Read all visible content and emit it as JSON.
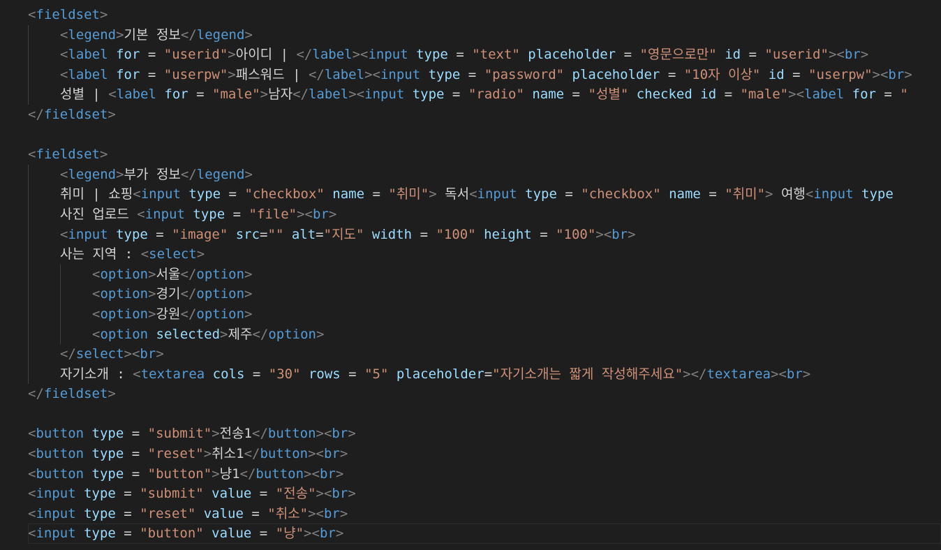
{
  "colors": {
    "background": "#1e1e1e",
    "tag": "#569cd6",
    "bracket": "#808080",
    "attribute": "#9cdcfe",
    "string": "#ce9178",
    "text": "#d4d4d4",
    "indent_guide": "#404040"
  },
  "lines": [
    {
      "indent": 0,
      "tokens": [
        [
          "p",
          "<"
        ],
        [
          "t",
          "fieldset"
        ],
        [
          "p",
          ">"
        ]
      ]
    },
    {
      "indent": 1,
      "tokens": [
        [
          "p",
          "<"
        ],
        [
          "t",
          "legend"
        ],
        [
          "p",
          ">"
        ],
        [
          "x",
          "기본 정보"
        ],
        [
          "p",
          "</"
        ],
        [
          "t",
          "legend"
        ],
        [
          "p",
          ">"
        ]
      ]
    },
    {
      "indent": 1,
      "tokens": [
        [
          "p",
          "<"
        ],
        [
          "t",
          "label "
        ],
        [
          "a",
          "for"
        ],
        [
          "x",
          " = "
        ],
        [
          "v",
          "\"userid\""
        ],
        [
          "p",
          ">"
        ],
        [
          "x",
          "아이디 | "
        ],
        [
          "p",
          "</"
        ],
        [
          "t",
          "label"
        ],
        [
          "p",
          "><"
        ],
        [
          "t",
          "input "
        ],
        [
          "a",
          "type"
        ],
        [
          "x",
          " = "
        ],
        [
          "v",
          "\"text\""
        ],
        [
          "x",
          " "
        ],
        [
          "a",
          "placeholder"
        ],
        [
          "x",
          " = "
        ],
        [
          "v",
          "\"영문으로만\""
        ],
        [
          "x",
          " "
        ],
        [
          "a",
          "id"
        ],
        [
          "x",
          " = "
        ],
        [
          "v",
          "\"userid\""
        ],
        [
          "p",
          "><"
        ],
        [
          "t",
          "br"
        ],
        [
          "p",
          ">"
        ]
      ]
    },
    {
      "indent": 1,
      "tokens": [
        [
          "p",
          "<"
        ],
        [
          "t",
          "label "
        ],
        [
          "a",
          "for"
        ],
        [
          "x",
          " = "
        ],
        [
          "v",
          "\"userpw\""
        ],
        [
          "p",
          ">"
        ],
        [
          "x",
          "패스워드 | "
        ],
        [
          "p",
          "</"
        ],
        [
          "t",
          "label"
        ],
        [
          "p",
          "><"
        ],
        [
          "t",
          "input "
        ],
        [
          "a",
          "type"
        ],
        [
          "x",
          " = "
        ],
        [
          "v",
          "\"password\""
        ],
        [
          "x",
          " "
        ],
        [
          "a",
          "placeholder"
        ],
        [
          "x",
          " = "
        ],
        [
          "v",
          "\"10자 이상\""
        ],
        [
          "x",
          " "
        ],
        [
          "a",
          "id"
        ],
        [
          "x",
          " = "
        ],
        [
          "v",
          "\"userpw\""
        ],
        [
          "p",
          "><"
        ],
        [
          "t",
          "br"
        ],
        [
          "p",
          ">"
        ]
      ]
    },
    {
      "indent": 1,
      "tokens": [
        [
          "x",
          "성별 | "
        ],
        [
          "p",
          "<"
        ],
        [
          "t",
          "label "
        ],
        [
          "a",
          "for"
        ],
        [
          "x",
          " = "
        ],
        [
          "v",
          "\"male\""
        ],
        [
          "p",
          ">"
        ],
        [
          "x",
          "남자"
        ],
        [
          "p",
          "</"
        ],
        [
          "t",
          "label"
        ],
        [
          "p",
          "><"
        ],
        [
          "t",
          "input "
        ],
        [
          "a",
          "type"
        ],
        [
          "x",
          " = "
        ],
        [
          "v",
          "\"radio\""
        ],
        [
          "x",
          " "
        ],
        [
          "a",
          "name"
        ],
        [
          "x",
          " = "
        ],
        [
          "v",
          "\"성별\""
        ],
        [
          "x",
          " "
        ],
        [
          "a",
          "checked"
        ],
        [
          "x",
          " "
        ],
        [
          "a",
          "id"
        ],
        [
          "x",
          " = "
        ],
        [
          "v",
          "\"male\""
        ],
        [
          "p",
          "><"
        ],
        [
          "t",
          "label "
        ],
        [
          "a",
          "for"
        ],
        [
          "x",
          " = "
        ],
        [
          "v",
          "\""
        ]
      ]
    },
    {
      "indent": 0,
      "tokens": [
        [
          "p",
          "</"
        ],
        [
          "t",
          "fieldset"
        ],
        [
          "p",
          ">"
        ]
      ]
    },
    {
      "indent": 0,
      "tokens": []
    },
    {
      "indent": 0,
      "tokens": [
        [
          "p",
          "<"
        ],
        [
          "t",
          "fieldset"
        ],
        [
          "p",
          ">"
        ]
      ]
    },
    {
      "indent": 1,
      "tokens": [
        [
          "p",
          "<"
        ],
        [
          "t",
          "legend"
        ],
        [
          "p",
          ">"
        ],
        [
          "x",
          "부가 정보"
        ],
        [
          "p",
          "</"
        ],
        [
          "t",
          "legend"
        ],
        [
          "p",
          ">"
        ]
      ]
    },
    {
      "indent": 1,
      "tokens": [
        [
          "x",
          "취미 | 쇼핑"
        ],
        [
          "p",
          "<"
        ],
        [
          "t",
          "input "
        ],
        [
          "a",
          "type"
        ],
        [
          "x",
          " = "
        ],
        [
          "v",
          "\"checkbox\""
        ],
        [
          "x",
          " "
        ],
        [
          "a",
          "name"
        ],
        [
          "x",
          " = "
        ],
        [
          "v",
          "\"취미\""
        ],
        [
          "p",
          ">"
        ],
        [
          "x",
          " 독서"
        ],
        [
          "p",
          "<"
        ],
        [
          "t",
          "input "
        ],
        [
          "a",
          "type"
        ],
        [
          "x",
          " = "
        ],
        [
          "v",
          "\"checkbox\""
        ],
        [
          "x",
          " "
        ],
        [
          "a",
          "name"
        ],
        [
          "x",
          " = "
        ],
        [
          "v",
          "\"취미\""
        ],
        [
          "p",
          ">"
        ],
        [
          "x",
          " 여행"
        ],
        [
          "p",
          "<"
        ],
        [
          "t",
          "input "
        ],
        [
          "a",
          "type"
        ]
      ]
    },
    {
      "indent": 1,
      "tokens": [
        [
          "x",
          "사진 업로드 "
        ],
        [
          "p",
          "<"
        ],
        [
          "t",
          "input "
        ],
        [
          "a",
          "type"
        ],
        [
          "x",
          " = "
        ],
        [
          "v",
          "\"file\""
        ],
        [
          "p",
          "><"
        ],
        [
          "t",
          "br"
        ],
        [
          "p",
          ">"
        ]
      ]
    },
    {
      "indent": 1,
      "tokens": [
        [
          "p",
          "<"
        ],
        [
          "t",
          "input "
        ],
        [
          "a",
          "type"
        ],
        [
          "x",
          " = "
        ],
        [
          "v",
          "\"image\""
        ],
        [
          "x",
          " "
        ],
        [
          "a",
          "src"
        ],
        [
          "x",
          "="
        ],
        [
          "v",
          "\"\""
        ],
        [
          "x",
          " "
        ],
        [
          "a",
          "alt"
        ],
        [
          "x",
          "="
        ],
        [
          "v",
          "\"지도\""
        ],
        [
          "x",
          " "
        ],
        [
          "a",
          "width"
        ],
        [
          "x",
          " = "
        ],
        [
          "v",
          "\"100\""
        ],
        [
          "x",
          " "
        ],
        [
          "a",
          "height"
        ],
        [
          "x",
          " = "
        ],
        [
          "v",
          "\"100\""
        ],
        [
          "p",
          "><"
        ],
        [
          "t",
          "br"
        ],
        [
          "p",
          ">"
        ]
      ]
    },
    {
      "indent": 1,
      "tokens": [
        [
          "x",
          "사는 지역 : "
        ],
        [
          "p",
          "<"
        ],
        [
          "t",
          "select"
        ],
        [
          "p",
          ">"
        ]
      ]
    },
    {
      "indent": 2,
      "tokens": [
        [
          "p",
          "<"
        ],
        [
          "t",
          "option"
        ],
        [
          "p",
          ">"
        ],
        [
          "x",
          "서울"
        ],
        [
          "p",
          "</"
        ],
        [
          "t",
          "option"
        ],
        [
          "p",
          ">"
        ]
      ]
    },
    {
      "indent": 2,
      "tokens": [
        [
          "p",
          "<"
        ],
        [
          "t",
          "option"
        ],
        [
          "p",
          ">"
        ],
        [
          "x",
          "경기"
        ],
        [
          "p",
          "</"
        ],
        [
          "t",
          "option"
        ],
        [
          "p",
          ">"
        ]
      ]
    },
    {
      "indent": 2,
      "tokens": [
        [
          "p",
          "<"
        ],
        [
          "t",
          "option"
        ],
        [
          "p",
          ">"
        ],
        [
          "x",
          "강원"
        ],
        [
          "p",
          "</"
        ],
        [
          "t",
          "option"
        ],
        [
          "p",
          ">"
        ]
      ]
    },
    {
      "indent": 2,
      "tokens": [
        [
          "p",
          "<"
        ],
        [
          "t",
          "option "
        ],
        [
          "a",
          "selected"
        ],
        [
          "p",
          ">"
        ],
        [
          "x",
          "제주"
        ],
        [
          "p",
          "</"
        ],
        [
          "t",
          "option"
        ],
        [
          "p",
          ">"
        ]
      ]
    },
    {
      "indent": 1,
      "tokens": [
        [
          "p",
          "</"
        ],
        [
          "t",
          "select"
        ],
        [
          "p",
          "><"
        ],
        [
          "t",
          "br"
        ],
        [
          "p",
          ">"
        ]
      ]
    },
    {
      "indent": 1,
      "tokens": [
        [
          "x",
          "자기소개 : "
        ],
        [
          "p",
          "<"
        ],
        [
          "t",
          "textarea "
        ],
        [
          "a",
          "cols"
        ],
        [
          "x",
          " = "
        ],
        [
          "v",
          "\"30\""
        ],
        [
          "x",
          " "
        ],
        [
          "a",
          "rows"
        ],
        [
          "x",
          " = "
        ],
        [
          "v",
          "\"5\""
        ],
        [
          "x",
          " "
        ],
        [
          "a",
          "placeholder"
        ],
        [
          "x",
          "="
        ],
        [
          "v",
          "\"자기소개는 짧게 작성해주세요\""
        ],
        [
          "p",
          "></"
        ],
        [
          "t",
          "textarea"
        ],
        [
          "p",
          "><"
        ],
        [
          "t",
          "br"
        ],
        [
          "p",
          ">"
        ]
      ]
    },
    {
      "indent": 0,
      "tokens": [
        [
          "p",
          "</"
        ],
        [
          "t",
          "fieldset"
        ],
        [
          "p",
          ">"
        ]
      ]
    },
    {
      "indent": 0,
      "tokens": []
    },
    {
      "indent": 0,
      "tokens": [
        [
          "p",
          "<"
        ],
        [
          "t",
          "button "
        ],
        [
          "a",
          "type"
        ],
        [
          "x",
          " = "
        ],
        [
          "v",
          "\"submit\""
        ],
        [
          "p",
          ">"
        ],
        [
          "x",
          "전송1"
        ],
        [
          "p",
          "</"
        ],
        [
          "t",
          "button"
        ],
        [
          "p",
          "><"
        ],
        [
          "t",
          "br"
        ],
        [
          "p",
          ">"
        ]
      ]
    },
    {
      "indent": 0,
      "tokens": [
        [
          "p",
          "<"
        ],
        [
          "t",
          "button "
        ],
        [
          "a",
          "type"
        ],
        [
          "x",
          " = "
        ],
        [
          "v",
          "\"reset\""
        ],
        [
          "p",
          ">"
        ],
        [
          "x",
          "취소1"
        ],
        [
          "p",
          "</"
        ],
        [
          "t",
          "button"
        ],
        [
          "p",
          "><"
        ],
        [
          "t",
          "br"
        ],
        [
          "p",
          ">"
        ]
      ]
    },
    {
      "indent": 0,
      "tokens": [
        [
          "p",
          "<"
        ],
        [
          "t",
          "button "
        ],
        [
          "a",
          "type"
        ],
        [
          "x",
          " = "
        ],
        [
          "v",
          "\"button\""
        ],
        [
          "p",
          ">"
        ],
        [
          "x",
          "냥1"
        ],
        [
          "p",
          "</"
        ],
        [
          "t",
          "button"
        ],
        [
          "p",
          "><"
        ],
        [
          "t",
          "br"
        ],
        [
          "p",
          ">"
        ]
      ]
    },
    {
      "indent": 0,
      "tokens": [
        [
          "p",
          "<"
        ],
        [
          "t",
          "input "
        ],
        [
          "a",
          "type"
        ],
        [
          "x",
          " = "
        ],
        [
          "v",
          "\"submit\""
        ],
        [
          "x",
          " "
        ],
        [
          "a",
          "value"
        ],
        [
          "x",
          " = "
        ],
        [
          "v",
          "\"전송\""
        ],
        [
          "p",
          "><"
        ],
        [
          "t",
          "br"
        ],
        [
          "p",
          ">"
        ]
      ]
    },
    {
      "indent": 0,
      "tokens": [
        [
          "p",
          "<"
        ],
        [
          "t",
          "input "
        ],
        [
          "a",
          "type"
        ],
        [
          "x",
          " = "
        ],
        [
          "v",
          "\"reset\""
        ],
        [
          "x",
          " "
        ],
        [
          "a",
          "value"
        ],
        [
          "x",
          " = "
        ],
        [
          "v",
          "\"취소\""
        ],
        [
          "p",
          "><"
        ],
        [
          "t",
          "br"
        ],
        [
          "p",
          ">"
        ]
      ]
    },
    {
      "indent": 0,
      "tokens": [
        [
          "p",
          "<"
        ],
        [
          "t",
          "input "
        ],
        [
          "a",
          "type"
        ],
        [
          "x",
          " = "
        ],
        [
          "v",
          "\"button\""
        ],
        [
          "x",
          " "
        ],
        [
          "a",
          "value"
        ],
        [
          "x",
          " = "
        ],
        [
          "v",
          "\"냥\""
        ],
        [
          "p",
          "><"
        ],
        [
          "t",
          "br"
        ],
        [
          "p",
          ">"
        ]
      ]
    }
  ]
}
